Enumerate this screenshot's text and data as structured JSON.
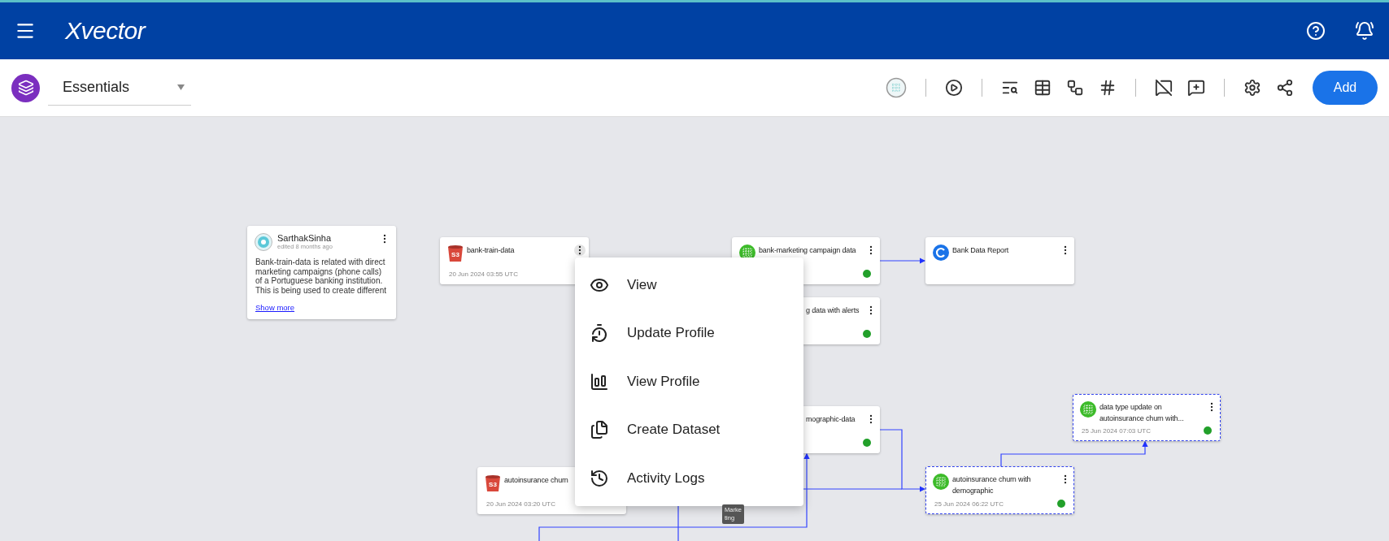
{
  "header": {
    "title": "Xvector"
  },
  "workspace": {
    "value": "Essentials"
  },
  "toolbar": {
    "groups": [
      [
        {
          "kind": "grid-globe",
          "disabled": true
        }
      ],
      [
        {
          "kind": "play",
          "disabled": false
        }
      ],
      [
        {
          "kind": "search-list",
          "disabled": false
        },
        {
          "kind": "table",
          "disabled": false
        },
        {
          "kind": "hierarchy",
          "disabled": false
        },
        {
          "kind": "hash",
          "disabled": false
        }
      ],
      [
        {
          "kind": "comment-off",
          "disabled": false
        },
        {
          "kind": "comment-add",
          "disabled": false
        }
      ],
      [
        {
          "kind": "settings",
          "disabled": false
        },
        {
          "kind": "share",
          "disabled": false
        }
      ]
    ],
    "add_label": "Add"
  },
  "note": {
    "author": "SarthakSinha",
    "meta": "edited 8 months ago",
    "body": "Bank-train-data is related with direct marketing campaigns (phone calls) of a Portuguese banking institution. This is being used to create different",
    "link": "Show more"
  },
  "nodes": [
    {
      "kind": "s3",
      "badge": "S3",
      "title": "bank-train-data",
      "date": "20 Jun 2024 03:55 UTC",
      "status_dot": false,
      "selected": false,
      "menu_open": true
    },
    {
      "kind": "dataset",
      "title": "bank-marketing campaign data",
      "status_dot": true,
      "selected": false
    },
    {
      "kind": "report",
      "title": "Bank Data Report",
      "status_dot": false,
      "selected": false
    },
    {
      "kind": "covered",
      "title": "g data with alerts",
      "status_dot": true,
      "selected": false
    },
    {
      "kind": "covered",
      "title": "mographic-data",
      "status_dot": true,
      "selected": false
    },
    {
      "kind": "s3",
      "badge": "S3",
      "title": "autoinsurance churn",
      "date": "20 Jun 2024 03:20 UTC",
      "status_dot": false,
      "selected": false
    },
    {
      "kind": "dataset",
      "title": "autoinsurance churn with demographic",
      "date": "25 Jun 2024 06:22 UTC",
      "status_dot": true,
      "selected": true
    },
    {
      "kind": "dataset",
      "title": "data type update on autoinsurance churn with...",
      "date": "25 Jun 2024 07:03 UTC",
      "status_dot": true,
      "selected": true
    }
  ],
  "context_menu": [
    {
      "kind": "view",
      "label": "View"
    },
    {
      "kind": "update",
      "label": "Update Profile"
    },
    {
      "kind": "profile",
      "label": "View Profile"
    },
    {
      "kind": "copy",
      "label": "Create Dataset"
    },
    {
      "kind": "history",
      "label": "Activity Logs"
    }
  ],
  "tooltip": "Marketing"
}
